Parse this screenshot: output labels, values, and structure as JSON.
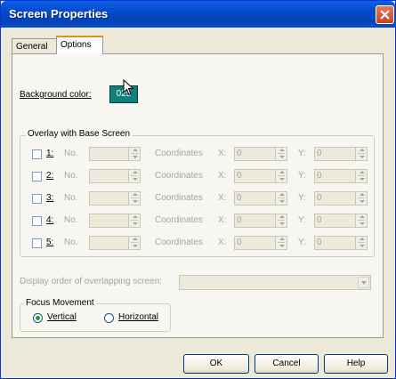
{
  "window": {
    "title": "Screen Properties"
  },
  "tabs": [
    {
      "label": "General"
    },
    {
      "label": "Options"
    }
  ],
  "background": {
    "label": "Background color:",
    "value": "025",
    "color": "#11807a"
  },
  "overlay": {
    "title": "Overlay with Base Screen",
    "no_label": "No.",
    "coord_label": "Coordinates",
    "x_label": "X:",
    "y_label": "Y:",
    "rows": [
      {
        "num": "1:",
        "x": "0",
        "y": "0"
      },
      {
        "num": "2:",
        "x": "0",
        "y": "0"
      },
      {
        "num": "3:",
        "x": "0",
        "y": "0"
      },
      {
        "num": "4:",
        "x": "0",
        "y": "0"
      },
      {
        "num": "5:",
        "x": "0",
        "y": "0"
      }
    ]
  },
  "display_order": {
    "label": "Display order of overlapping screen:",
    "value": ""
  },
  "focus": {
    "title": "Focus Movement",
    "vertical": "Vertical",
    "horizontal": "Horizontal",
    "selected": "Vertical"
  },
  "buttons": {
    "ok": "OK",
    "cancel": "Cancel",
    "help": "Help"
  }
}
